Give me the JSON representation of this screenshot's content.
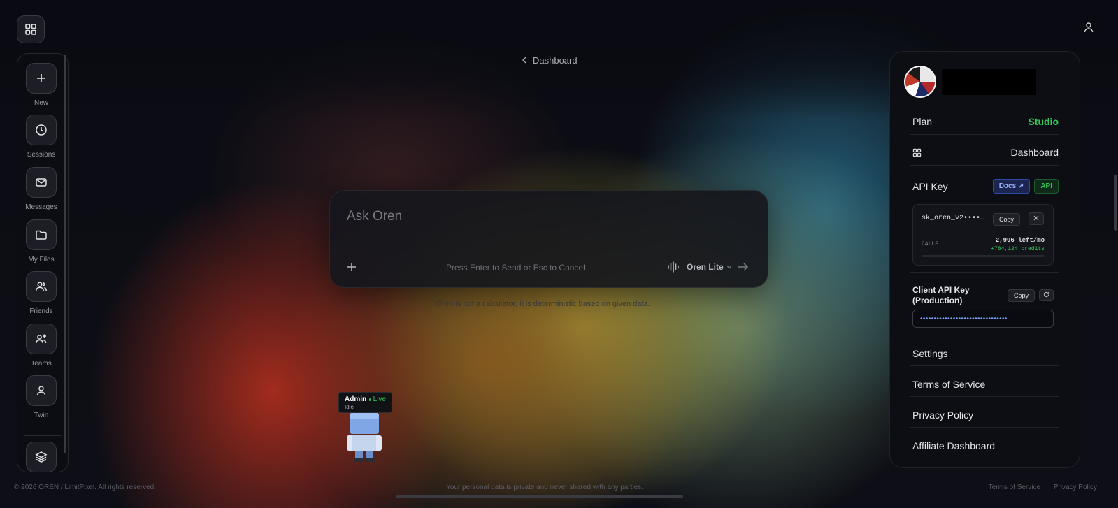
{
  "nav": {
    "grid_icon": "grid-icon",
    "items": [
      {
        "label": "New",
        "icon": "plus-icon"
      },
      {
        "label": "Sessions",
        "icon": "clock-icon"
      },
      {
        "label": "Messages",
        "icon": "mail-icon"
      },
      {
        "label": "My Files",
        "icon": "folder-icon"
      },
      {
        "label": "Friends",
        "icon": "users-icon"
      },
      {
        "label": "Teams",
        "icon": "team-icon"
      },
      {
        "label": "Twin",
        "icon": "user-icon"
      }
    ],
    "layers_icon": "layers-icon"
  },
  "breadcrumb": {
    "label": "Dashboard"
  },
  "ask": {
    "placeholder": "Ask Oren",
    "hint": "Press Enter to Send or Esc to Cancel",
    "model": "Oren Lite"
  },
  "disclaimer": "Oren is not a calculator; it is deterministic based on given data.",
  "admin": {
    "name": "Admin",
    "status": "Live",
    "sub": "Idle"
  },
  "footer": {
    "copyright": "© 2026 OREN / LimitPixel. All rights reserved.",
    "privacy_note": "Your personal data is private and never shared with any parties.",
    "links": [
      "Terms of Service",
      "Privacy Policy"
    ]
  },
  "panel": {
    "plan_label": "Plan",
    "plan_value": "Studio",
    "dashboard_label": "Dashboard",
    "api_key_label": "API Key",
    "docs_tag": "Docs ↗",
    "api_tag": "API",
    "key_value": "sk_oren_v2••••…",
    "copy_label": "Copy",
    "calls_label": "CALLS",
    "calls_left": "2,996 left/mo",
    "credits": "+784,124 credits",
    "client_key_label": "Client API Key (Production)",
    "client_copy_label": "Copy",
    "client_key_value": "••••••••••••••••••••••••••••••••",
    "menu": [
      "Settings",
      "Terms of Service",
      "Privacy Policy",
      "Affiliate Dashboard"
    ]
  },
  "colors": {
    "accent_green": "#34c759",
    "accent_blue": "#7aa2ff"
  }
}
